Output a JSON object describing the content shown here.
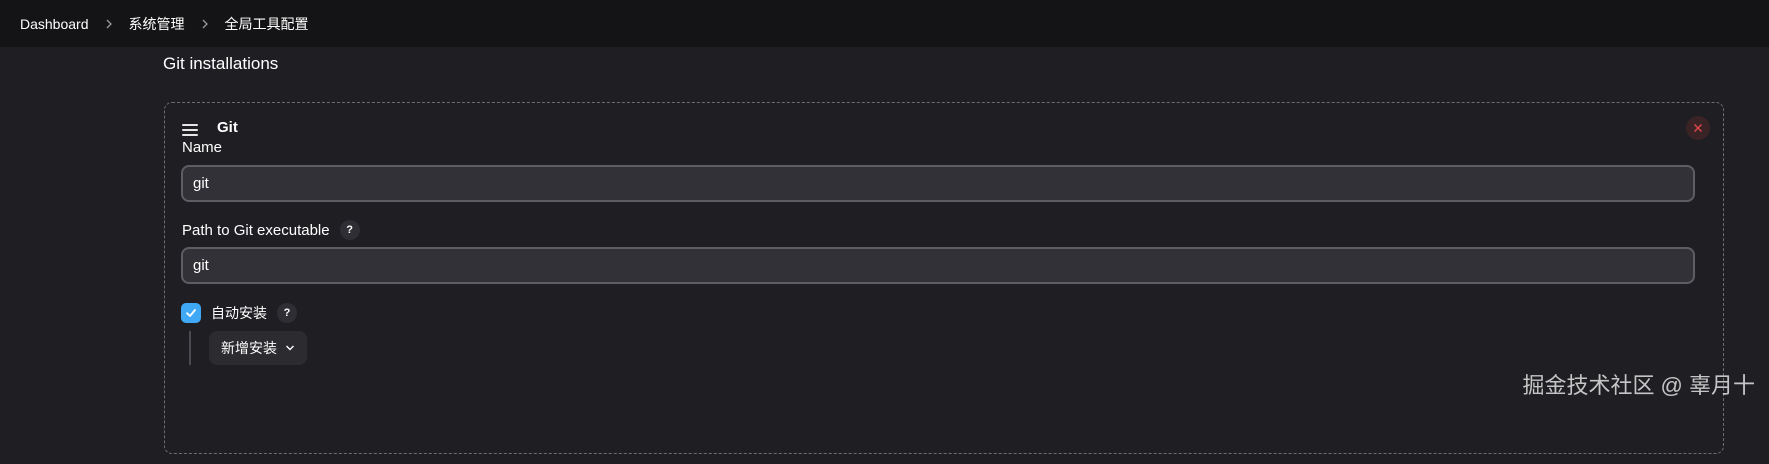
{
  "breadcrumb": {
    "items": [
      "Dashboard",
      "系统管理",
      "全局工具配置"
    ]
  },
  "section": {
    "title": "Git installations"
  },
  "git_card": {
    "title": "Git",
    "name_label": "Name",
    "name_value": "git",
    "path_label": "Path to Git executable",
    "path_value": "git",
    "help_glyph": "?",
    "auto_install_label": "自动安装",
    "auto_install_checked": true,
    "add_installer_label": "新增安装"
  },
  "watermark": "掘金技术社区 @ 辜月十",
  "icons": {
    "drag": "drag-handle-icon",
    "close": "close-icon",
    "chevron": "chevron-down-icon",
    "separator": "chevron-right-icon",
    "check": "check-icon"
  },
  "colors": {
    "background": "#1f1f23",
    "topbar": "#141416",
    "accent": "#3fa9f5",
    "danger": "#e0474c"
  }
}
